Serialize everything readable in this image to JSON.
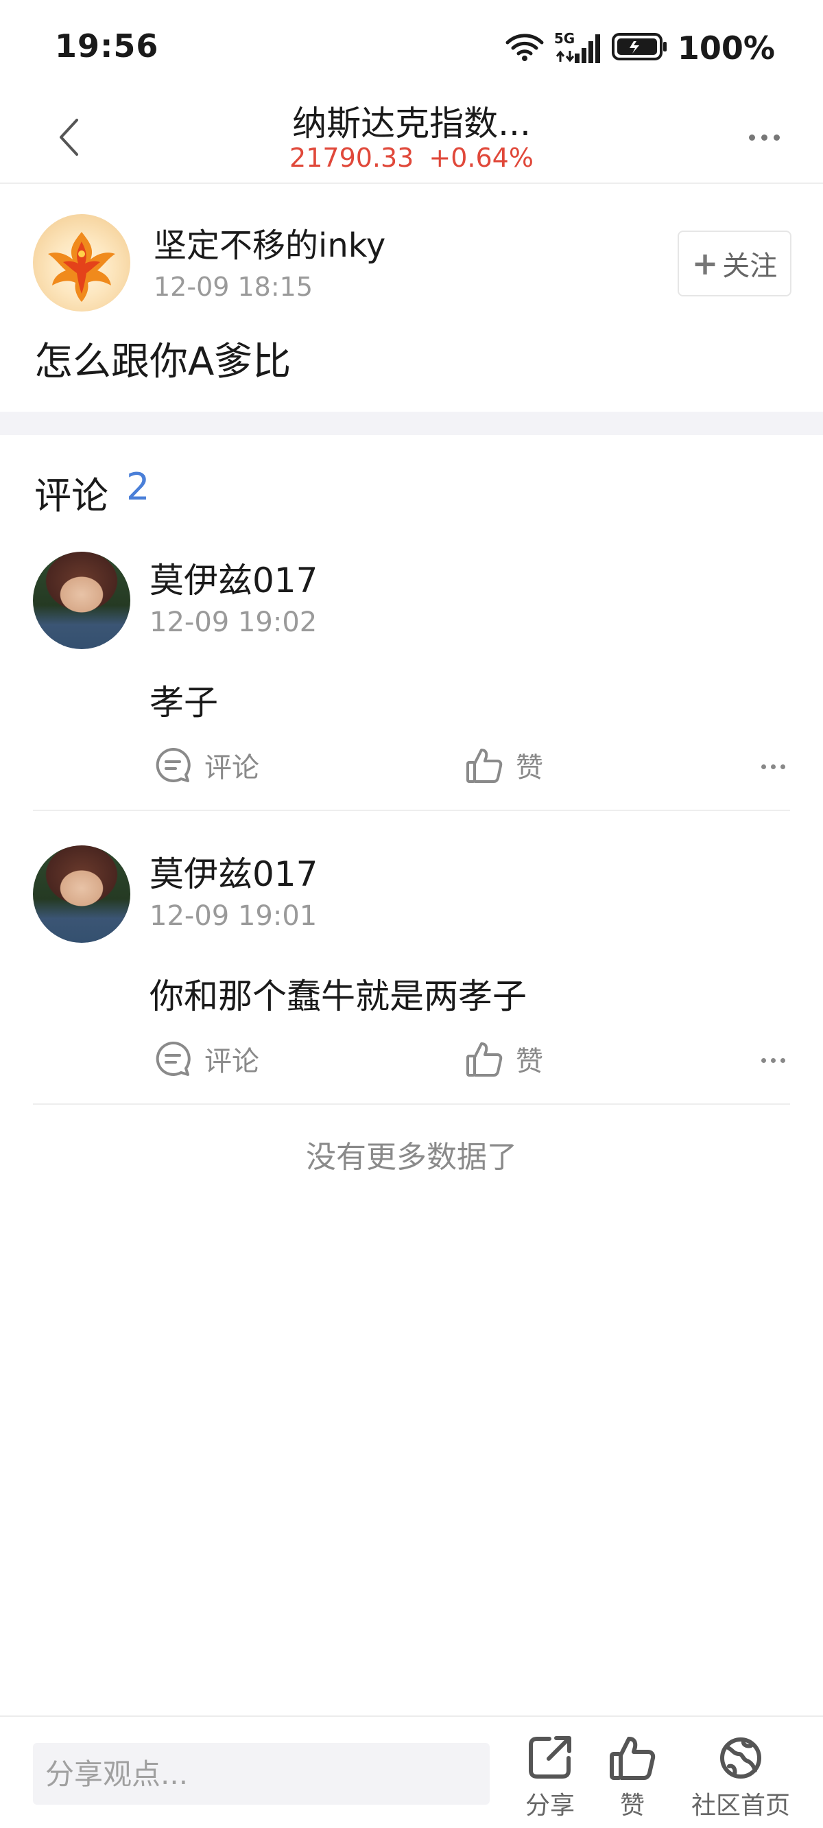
{
  "status_bar": {
    "time": "19:56",
    "battery": "100%",
    "network": "5G",
    "icons": [
      "wifi-icon",
      "5g-signal-icon",
      "battery-icon"
    ]
  },
  "nav": {
    "title": "纳斯达克指数...",
    "index_value": "21790.33",
    "index_change": "+0.64%",
    "change_color": "#e0483a"
  },
  "post": {
    "author": "坚定不移的inky",
    "time": "12-09 18:15",
    "follow_label": "关注",
    "follow_plus": "+",
    "body": "怎么跟你A爹比"
  },
  "comments": {
    "label": "评论",
    "count": "2",
    "count_color": "#4a7fd8",
    "items": [
      {
        "name": "莫伊兹017",
        "time": "12-09 19:02",
        "text": "孝子",
        "comment_label": "评论",
        "like_label": "赞"
      },
      {
        "name": "莫伊兹017",
        "time": "12-09 19:01",
        "text": "你和那个蠢牛就是两孝子",
        "comment_label": "评论",
        "like_label": "赞"
      }
    ],
    "no_more": "没有更多数据了"
  },
  "bottom_bar": {
    "placeholder": "分享观点...",
    "share_label": "分享",
    "like_label": "赞",
    "community_label": "社区首页"
  }
}
